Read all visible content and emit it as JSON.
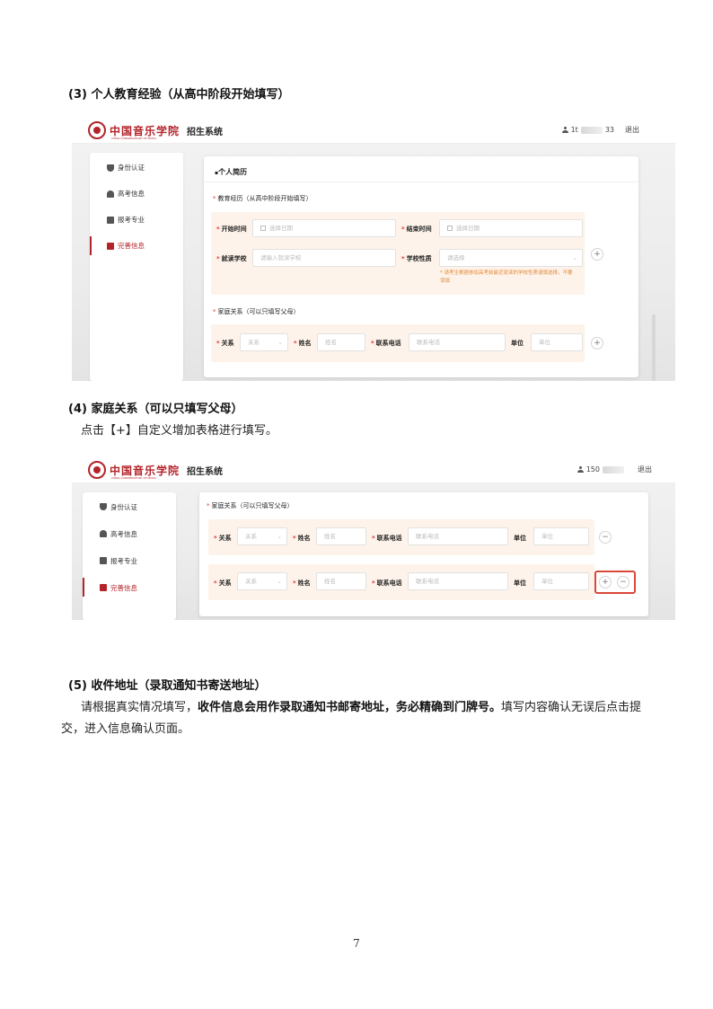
{
  "section3": {
    "heading": "(3) 个人教育经验（从高中阶段开始填写）"
  },
  "section4": {
    "heading": "(4) 家庭关系（可以只填写父母）",
    "instruction": "点击【+】自定义增加表格进行填写。"
  },
  "section5": {
    "heading": "(5) 收件地址（录取通知书寄送地址）",
    "text_before": "请根据真实情况填写，",
    "text_bold": "收件信息会用作录取通知书邮寄地址，务必精确到门牌号。",
    "text_after": "填写内容确认无误后点击提交，进入信息确认页面。"
  },
  "page_number": "7",
  "app": {
    "logo_text": "中国音乐学院",
    "logo_subtext": "CHINA CONSERVATORY OF MUSIC",
    "system_title": "招生系统",
    "logout": "退出",
    "accent_color": "#b3242a",
    "panel_color": "#fdf3ea"
  },
  "screenshot1": {
    "user_prefix": "1t",
    "user_suffix": "33",
    "sidebar": [
      "身份认证",
      "高考信息",
      "报考专业",
      "完善信息"
    ],
    "card_title": "个人简历",
    "edu_label": "教育经历（从高中阶段开始填写）",
    "start_time_label": "开始时间",
    "start_time_placeholder": "选择日期",
    "end_time_label": "结束时间",
    "end_time_placeholder": "选择日期",
    "school_label": "就读学校",
    "school_placeholder": "请输入就读学校",
    "school_type_label": "学校性质",
    "school_type_placeholder": "请选择",
    "school_hint": "* 请考生根据参加高考前最近就读的学校性质谨慎选择，不要误填",
    "family_label": "家庭关系（可以只填写父母）",
    "relation_label": "关系",
    "relation_placeholder": "关系",
    "name_label": "姓名",
    "name_placeholder": "姓名",
    "phone_label": "联系电话",
    "phone_placeholder": "联系电话",
    "unit_label": "单位",
    "unit_placeholder": "单位",
    "plus": "+"
  },
  "screenshot2": {
    "user_prefix": "150",
    "sidebar": [
      "身份认证",
      "高考信息",
      "报考专业",
      "完善信息"
    ],
    "family_label": "家庭关系（可以只填写父母）",
    "relation_label": "关系",
    "relation_placeholder": "关系",
    "name_label": "姓名",
    "name_placeholder": "姓名",
    "phone_label": "联系电话",
    "phone_placeholder": "联系电话",
    "unit_label": "单位",
    "unit_placeholder": "单位",
    "plus": "+",
    "minus": "−"
  }
}
